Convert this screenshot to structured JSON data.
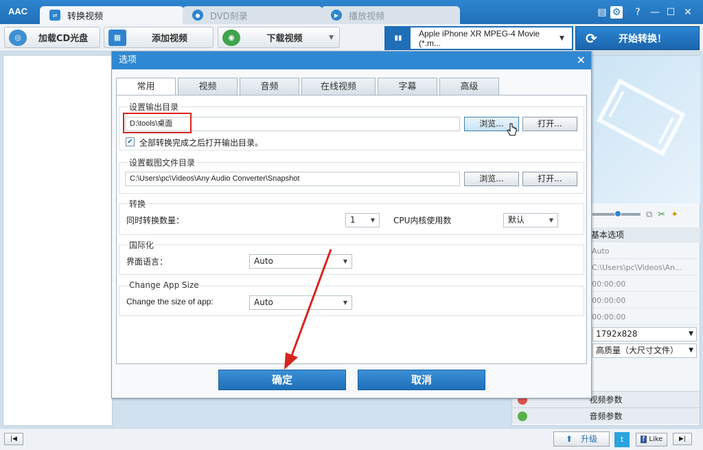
{
  "app": {
    "logo": "AAC",
    "tabs": [
      {
        "label": "转换视频",
        "icon": "convert-icon"
      },
      {
        "label": "DVD刻录",
        "icon": "disc-icon"
      },
      {
        "label": "播放视频",
        "icon": "play-icon"
      }
    ],
    "window_controls": [
      "skin-icon",
      "settings-icon",
      "help-icon",
      "minimize-icon",
      "maximize-icon",
      "close-icon"
    ]
  },
  "toolbar": {
    "load_cd": "加载CD光盘",
    "add_video": "添加视频",
    "download_video": "下载视频",
    "profile": "Apple iPhone XR MPEG-4 Movie (*.m...",
    "start": "开始转换！"
  },
  "right_panel": {
    "basic_options": "基本选项",
    "rows": [
      "Auto",
      "C:\\Users\\pc\\Videos\\An...",
      "00:00:00",
      "00:00:00",
      "00:00:00"
    ],
    "resolution": "1792x828",
    "quality": "高质量（大尺寸文件）",
    "video_params": "视频参数",
    "audio_params": "音频参数"
  },
  "statusbar": {
    "upgrade": "升级",
    "like": "Like"
  },
  "dialog": {
    "title": "选项",
    "tabs": [
      "常用",
      "视频",
      "音频",
      "在线视频",
      "字幕",
      "高级"
    ],
    "output": {
      "title": "设置输出目录",
      "path": "D:\\tools\\桌面",
      "browse": "浏览...",
      "open": "打开...",
      "checkbox": "全部转换完成之后打开输出目录。",
      "checked": true
    },
    "snapshot": {
      "title": "设置截图文件目录",
      "path": "C:\\Users\\pc\\Videos\\Any Audio Converter\\Snapshot",
      "browse": "浏览...",
      "open": "打开..."
    },
    "convert": {
      "title": "转换",
      "count_label": "同时转换数量：",
      "count_value": "1",
      "cpu_label": "CPU内核使用数",
      "cpu_value": "默认"
    },
    "i18n": {
      "title": "国际化",
      "lang_label": "界面语言：",
      "lang_value": "Auto"
    },
    "appsize": {
      "title": "Change App Size",
      "label": "Change the size of app:",
      "value": "Auto"
    },
    "ok": "确定",
    "cancel": "取消"
  },
  "colors": {
    "accent": "#1f6fb8",
    "highlight": "#d9241d"
  }
}
